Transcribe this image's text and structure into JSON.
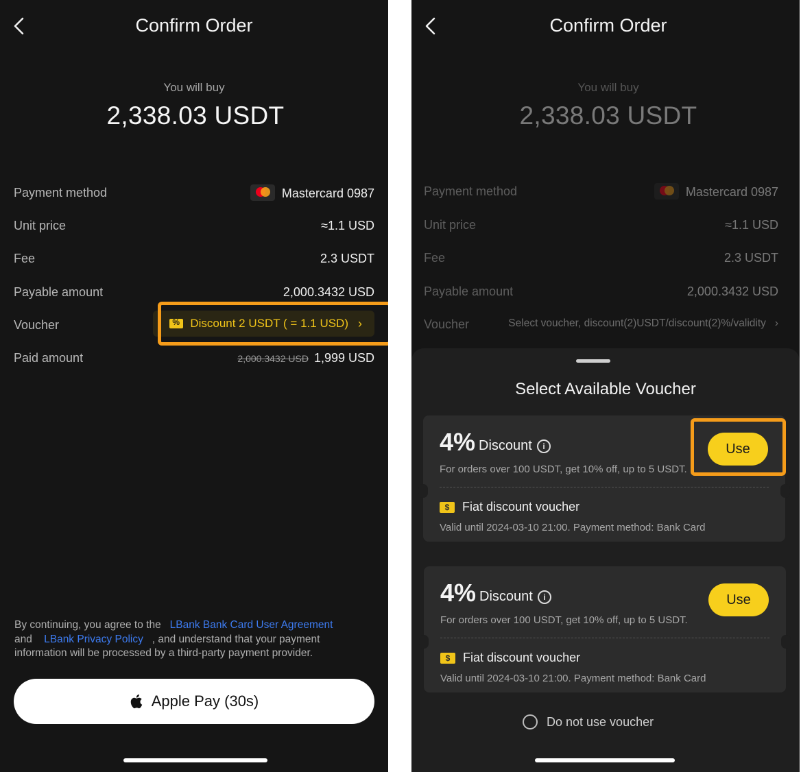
{
  "left": {
    "title": "Confirm Order",
    "buy_label": "You will buy",
    "buy_amount": "2,338.03 USDT",
    "rows": {
      "payment_method": {
        "label": "Payment method",
        "value": "Mastercard 0987"
      },
      "unit_price": {
        "label": "Unit price",
        "value": "≈1.1 USD"
      },
      "fee": {
        "label": "Fee",
        "value": "2.3 USDT"
      },
      "payable": {
        "label": "Payable amount",
        "value": "2,000.3432 USD"
      },
      "voucher": {
        "label": "Voucher",
        "value": "Discount 2 USDT ( = 1.1 USD)"
      },
      "paid": {
        "label": "Paid amount",
        "original": "2,000.3432 USD",
        "value": "1,999 USD"
      }
    },
    "terms": {
      "prefix": "By continuing, you agree to the",
      "link1": "LBank Bank Card User Agreement",
      "and": "and",
      "link2": "LBank Privacy Policy",
      "suffix": ", and understand that your payment information will be processed by a third-party payment provider."
    },
    "apple_pay_label": "Apple Pay (30s)"
  },
  "right": {
    "title": "Confirm Order",
    "buy_label": "You will buy",
    "buy_amount": "2,338.03 USDT",
    "rows": {
      "payment_method": {
        "label": "Payment method",
        "value": "Mastercard 0987"
      },
      "unit_price": {
        "label": "Unit price",
        "value": "≈1.1 USD"
      },
      "fee": {
        "label": "Fee",
        "value": "2.3 USDT"
      },
      "payable": {
        "label": "Payable amount",
        "value": "2,000.3432 USD"
      },
      "voucher": {
        "label": "Voucher",
        "value": "Select voucher, discount(2)USDT/discount(2)%/validity"
      }
    },
    "sheet": {
      "title": "Select Available Voucher",
      "vouchers": [
        {
          "percent": "4%",
          "word": "Discount",
          "desc": "For orders over 100 USDT, get 10% off, up to 5 USDT.",
          "use": "Use",
          "type": "Fiat discount voucher",
          "valid": "Valid until 2024-03-10 21:00. Payment method: Bank Card"
        },
        {
          "percent": "4%",
          "word": "Discount",
          "desc": "For orders over 100 USDT, get 10% off, up to 5 USDT.",
          "use": "Use",
          "type": "Fiat discount voucher",
          "valid": "Valid until 2024-03-10 21:00. Payment method: Bank Card"
        }
      ],
      "no_voucher": "Do not use voucher"
    }
  },
  "colors": {
    "accent": "#f7cf1c",
    "highlight": "#f59c1a",
    "link": "#3d7bf0",
    "background": "#151515"
  }
}
